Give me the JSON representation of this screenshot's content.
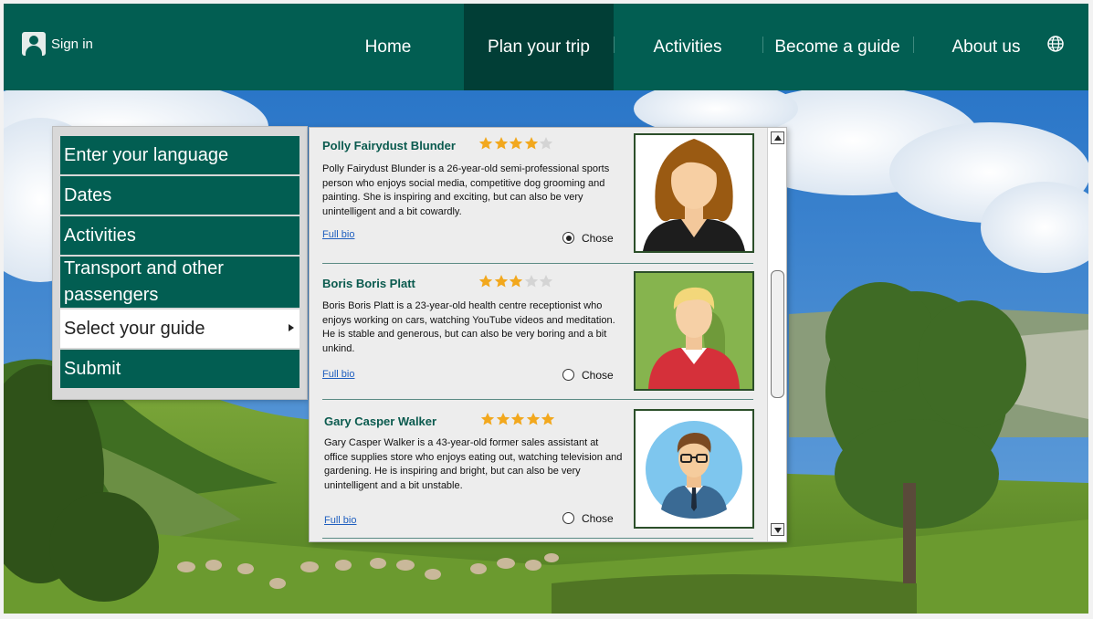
{
  "header": {
    "sign_in_label": "Sign in",
    "nav": [
      {
        "label": "Home",
        "active": false
      },
      {
        "label": "Plan your trip",
        "active": true
      },
      {
        "label": "Activities",
        "active": false
      },
      {
        "label": "Become a guide",
        "active": false
      },
      {
        "label": "About us",
        "active": false
      }
    ],
    "language_icon": "globe-icon"
  },
  "steps": [
    {
      "label": "Enter your language",
      "selected": false
    },
    {
      "label": "Dates",
      "selected": false
    },
    {
      "label": "Activities",
      "selected": false
    },
    {
      "label": "Transport and other passengers",
      "selected": false
    },
    {
      "label": "Select your guide",
      "selected": true
    },
    {
      "label": "Submit",
      "selected": false
    }
  ],
  "guides": [
    {
      "name": "Polly Fairydust Blunder",
      "rating": 4,
      "max_rating": 5,
      "description": "Polly Fairydust Blunder is a 26-year-old semi-professional sports person who enjoys social media, competitive dog grooming and painting. She is inspiring and exciting, but can also be very unintelligent and a  bit cowardly.",
      "bio_link": "Full bio",
      "choose_label": "Chose",
      "chosen": true
    },
    {
      "name": "Boris Boris Platt",
      "rating": 3,
      "max_rating": 5,
      "description": "Boris Boris Platt is a 23-year-old health centre receptionist who enjoys working on cars, watching YouTube videos and meditation. He is stable and generous, but can also be very boring and a  bit unkind.",
      "bio_link": "Full bio",
      "choose_label": "Chose",
      "chosen": false
    },
    {
      "name": "Gary Casper Walker",
      "rating": 5,
      "max_rating": 5,
      "description": "Gary Casper Walker is a 43-year-old former sales assistant at office supplies store who enjoys eating out, watching television and gardening. He is inspiring and bright, but can also be very unintelligent and a  bit unstable.",
      "bio_link": "Full bio",
      "choose_label": "Chose",
      "chosen": false
    }
  ],
  "colors": {
    "brand": "#025e52",
    "nav_active": "#013e36",
    "star_on": "#f2a81e",
    "star_off": "#d4d4d4",
    "link": "#1f5fbf"
  }
}
